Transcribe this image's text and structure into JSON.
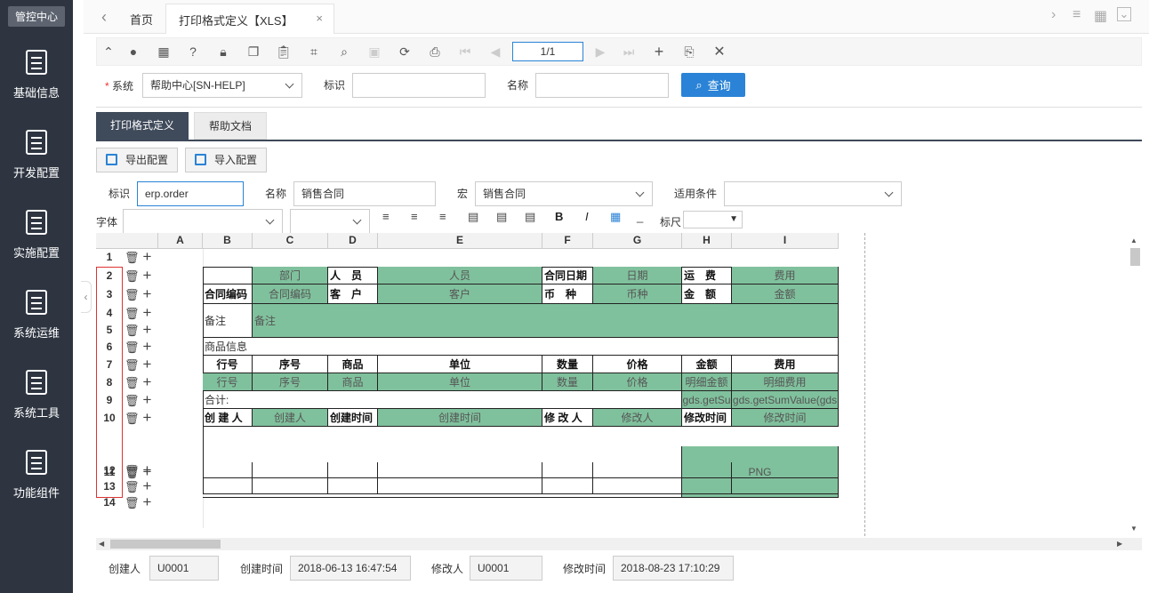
{
  "sidebar": {
    "top": "管控中心",
    "items": [
      {
        "label": "基础信息"
      },
      {
        "label": "开发配置"
      },
      {
        "label": "实施配置"
      },
      {
        "label": "系统运维"
      },
      {
        "label": "系统工具"
      },
      {
        "label": "功能组件"
      }
    ]
  },
  "tabs": {
    "home": "首页",
    "active": "打印格式定义【XLS】",
    "close": "×"
  },
  "toolbar": {
    "page": "1/1"
  },
  "search": {
    "system_label": "系统",
    "system_required": "*",
    "system_value": "帮助中心[SN-HELP]",
    "id_label": "标识",
    "name_label": "名称",
    "query_label": "查询"
  },
  "subtabs": {
    "tab1": "打印格式定义",
    "tab2": "帮助文档"
  },
  "config_buttons": {
    "export": "导出配置",
    "import": "导入配置"
  },
  "form": {
    "id_label": "标识",
    "id_value": "erp.order",
    "name_label": "名称",
    "name_value": "销售合同",
    "macro_label": "宏",
    "macro_value": "销售合同",
    "cond_label": "适用条件",
    "font_label": "字体",
    "ruler_label": "标尺",
    "ruler_arrow": "▼"
  },
  "sheet": {
    "columns": [
      "A",
      "B",
      "C",
      "D",
      "E",
      "F",
      "G",
      "H",
      "I"
    ],
    "rows": [
      "1",
      "2",
      "3",
      "4",
      "5",
      "6",
      "7",
      "8",
      "9",
      "10",
      "11",
      "12",
      "13",
      "14"
    ],
    "cells": {
      "r2": [
        "部门",
        "人　员",
        "人员",
        "合同日期",
        "日期",
        "运　费",
        "费用"
      ],
      "r3": [
        "合同编码",
        "合同编码",
        "客　户",
        "客户",
        "币　种",
        "币种",
        "金　额",
        "金额"
      ],
      "r45": [
        "备注",
        "备注"
      ],
      "r6": "商品信息",
      "r7": [
        "行号",
        "序号",
        "商品",
        "单位",
        "数量",
        "价格",
        "金额",
        "费用"
      ],
      "r8": [
        "行号",
        "序号",
        "商品",
        "单位",
        "数量",
        "价格",
        "明细金额",
        "明细费用"
      ],
      "r9": [
        "合计:",
        "gds.getSu",
        "gds.getSumValue(gds"
      ],
      "r10": [
        "创 建 人",
        "创建人",
        "创建时间",
        "创建时间",
        "修 改 人",
        "修改人",
        "修改时间",
        "修改时间"
      ],
      "r11": "PNG"
    }
  },
  "footer": {
    "creator_label": "创建人",
    "creator": "U0001",
    "create_time_label": "创建时间",
    "create_time": "2018-06-13 16:47:54",
    "modifier_label": "修改人",
    "modifier": "U0001",
    "modify_time_label": "修改时间",
    "modify_time": "2018-08-23 17:10:29"
  },
  "colors": {
    "sidebar": "#2e3541",
    "accent": "#2a83d6",
    "cell_green": "#80c19d",
    "tab_dark": "#3f4a5a"
  }
}
